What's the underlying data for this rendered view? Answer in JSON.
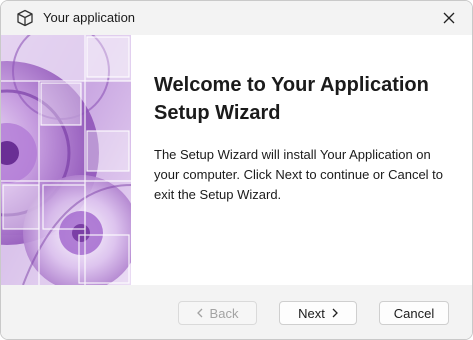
{
  "window": {
    "title": "Your application"
  },
  "content": {
    "heading": "Welcome to Your Application Setup Wizard",
    "body": "The Setup Wizard will install Your Application on your computer. Click Next to continue or Cancel to exit the Setup Wizard."
  },
  "buttons": {
    "back": "Back",
    "next": "Next",
    "cancel": "Cancel"
  },
  "icons": {
    "app": "package-cube-icon",
    "close": "close-icon",
    "back": "chevron-left-icon",
    "next": "chevron-right-icon"
  },
  "colors": {
    "banner_dark": "#7b3fa6",
    "banner_light": "#e6d6f2",
    "titlebar_bg": "#f3f3f3"
  }
}
